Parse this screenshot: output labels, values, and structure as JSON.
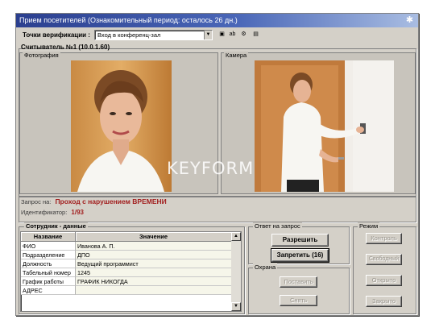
{
  "window": {
    "title": "Прием посетителей (Ознакомительный период: осталось 26 дн.)"
  },
  "toolbar": {
    "verification_label": "Точки верификации :",
    "verification_value": "Вход в конференц-зал"
  },
  "reader": {
    "title": "Считыватель №1 (10.0.1.60)",
    "photo_label": "Фотография",
    "camera_label": "Камера"
  },
  "watermark": "KEYFORM",
  "request": {
    "label": "Запрос на:",
    "value": "Проход с нарушением ВРЕМЕНИ",
    "id_label": "Идентификатор:",
    "id_value": "1/93"
  },
  "employee": {
    "header": "Сотрудник - данные",
    "columns": [
      "Название",
      "Значение"
    ],
    "rows": [
      [
        "ФИО",
        "Иванова А. П."
      ],
      [
        "Подразделение",
        "ДПО"
      ],
      [
        "Должность",
        "Ведущий программист"
      ],
      [
        "Табельный номер",
        "1245"
      ],
      [
        "График работы",
        "ГРАФИК НИКОГДА"
      ],
      [
        "АДРЕС",
        ""
      ]
    ]
  },
  "response": {
    "header": "Ответ на запрос",
    "allow": "Разрешить",
    "deny": "Запретить (16)"
  },
  "guard": {
    "header": "Охрана",
    "arm": "Поставить",
    "disarm": "Снять"
  },
  "mode": {
    "header": "Режим",
    "control": "Контроль",
    "free": "Свободный",
    "open": "Открыто",
    "closed": "Закрыто"
  },
  "colors": {
    "title_start": "#2b3f8f",
    "title_end": "#a9bde2",
    "alert_text": "#a21f1f",
    "window_bg": "#d4d0c8"
  }
}
